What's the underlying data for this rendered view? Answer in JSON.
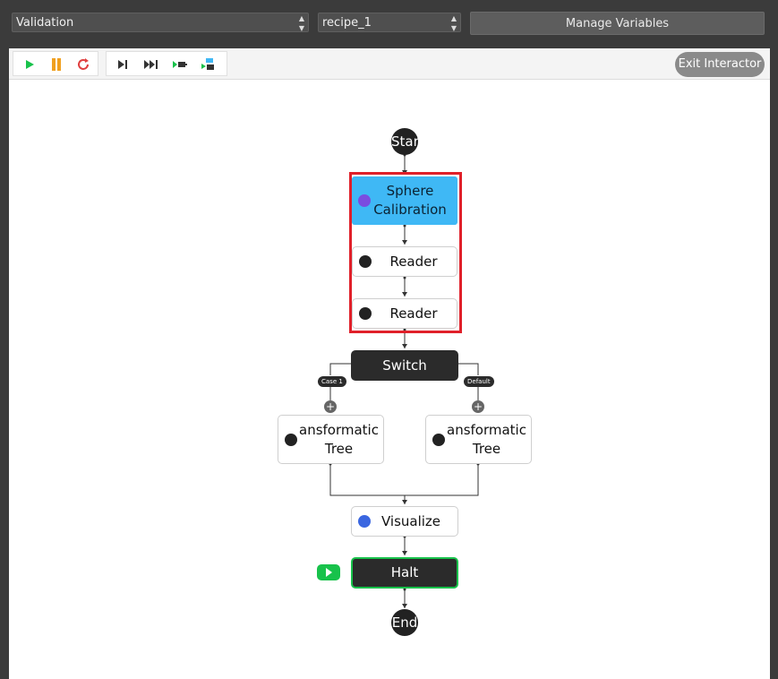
{
  "topbar": {
    "pipeline_select": "Validation",
    "recipe_select": "recipe_1",
    "manage_label": "Manage Variables"
  },
  "toolbar": {
    "buttons": [
      "run-icon",
      "pause-icon",
      "reset-icon",
      "step-icon",
      "fast-forward-icon",
      "step-into-icon",
      "step-node-icon"
    ],
    "exit_label": "Exit Interactor"
  },
  "flow": {
    "start": "Start",
    "sphere": "Sphere\nCalibration",
    "reader1": "Reader",
    "reader2": "Reader",
    "switch": "Switch",
    "case1": "Case 1",
    "default": "Default",
    "tree_left": "ansformatic\nTree",
    "tree_right": "ansformatic\nTree",
    "visualize": "Visualize",
    "halt": "Halt",
    "end": "End"
  },
  "colors": {
    "accent_blue": "#3fb8f5",
    "highlight_red": "#e0202a",
    "run_green": "#18c24b",
    "pause_orange": "#f0a020",
    "reset_red": "#e04040"
  }
}
